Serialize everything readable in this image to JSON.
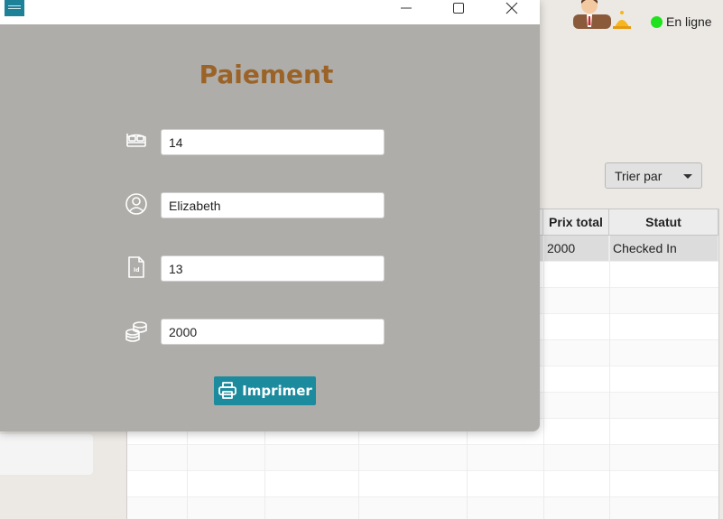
{
  "header": {
    "status_label": "En ligne",
    "status_color": "#1fe21f"
  },
  "toolbar": {
    "sort_label": "Trier par"
  },
  "table": {
    "columns": [
      "Prix total",
      "Statut"
    ],
    "rows": [
      [
        "2000",
        "Checked In"
      ]
    ]
  },
  "dialog": {
    "title": "Paiement",
    "fields": {
      "room": {
        "value": "14",
        "icon": "bed-icon"
      },
      "client": {
        "value": "Elizabeth",
        "icon": "user-circle-icon"
      },
      "id": {
        "value": "13",
        "icon": "id-document-icon"
      },
      "amount": {
        "value": "2000",
        "icon": "coins-icon"
      }
    },
    "print_label": "Imprimer",
    "accent_color": "#1d8b9e",
    "title_color": "#9b6327"
  }
}
